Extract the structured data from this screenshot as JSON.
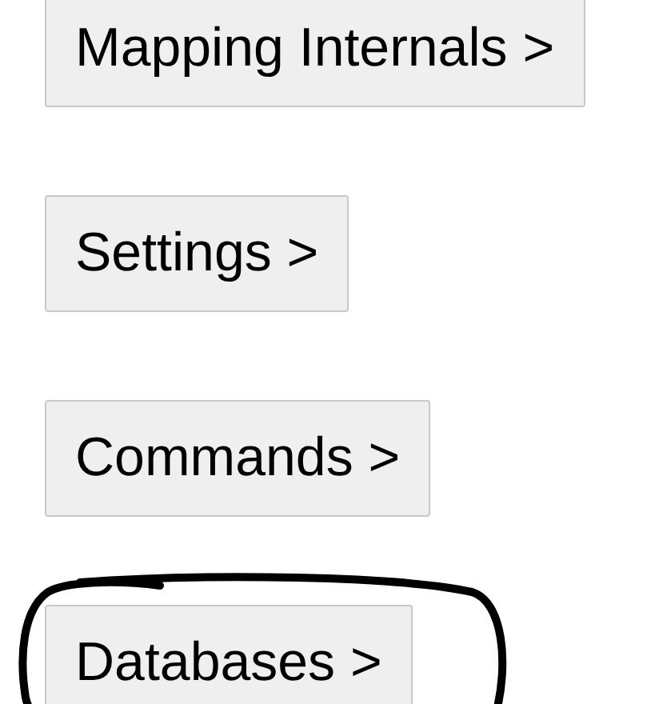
{
  "buttons": [
    {
      "label": "Mapping Internals >",
      "highlighted": false
    },
    {
      "label": "Settings >",
      "highlighted": false
    },
    {
      "label": "Commands >",
      "highlighted": false
    },
    {
      "label": "Databases >",
      "highlighted": true
    }
  ]
}
